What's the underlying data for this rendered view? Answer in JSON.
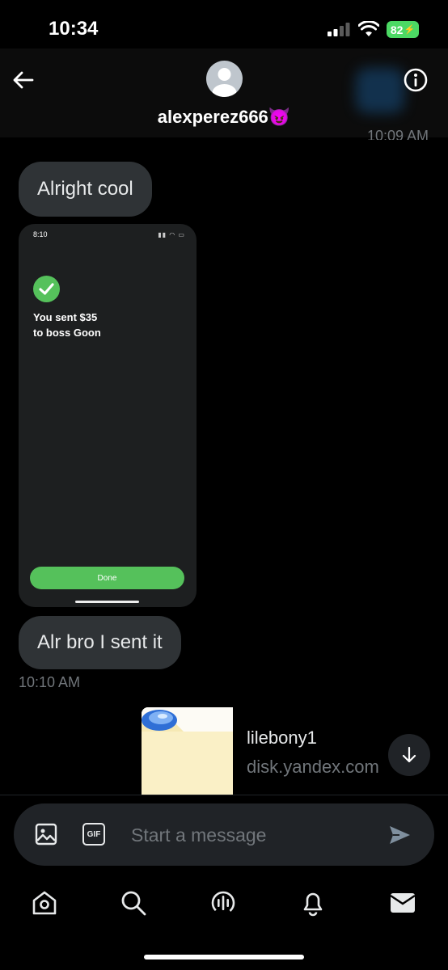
{
  "status_bar": {
    "time": "10:34",
    "battery": "82"
  },
  "header": {
    "contact_name": "alexperez666",
    "contact_emoji": "😈",
    "clipped_time": "10:09 AM"
  },
  "messages": {
    "bubble_1": "Alright cool",
    "screenshot": {
      "time": "8:10",
      "message_line_1": "You sent $35",
      "message_line_2": "to boss Goon",
      "done_label": "Done"
    },
    "bubble_2": "Alr bro I sent it",
    "timestamp": "10:10 AM",
    "link_card": {
      "title": "lilebony1",
      "domain": "disk.yandex.com"
    }
  },
  "composer": {
    "placeholder": "Start a message",
    "gif_label": "GIF"
  },
  "nav": {
    "icons": [
      "home-icon",
      "search-icon",
      "spaces-icon",
      "notifications-icon",
      "messages-icon"
    ]
  },
  "colors": {
    "background": "#000000",
    "bubble": "#2f3336",
    "accent_green": "#55c15b",
    "secondary_text": "#71767b"
  }
}
